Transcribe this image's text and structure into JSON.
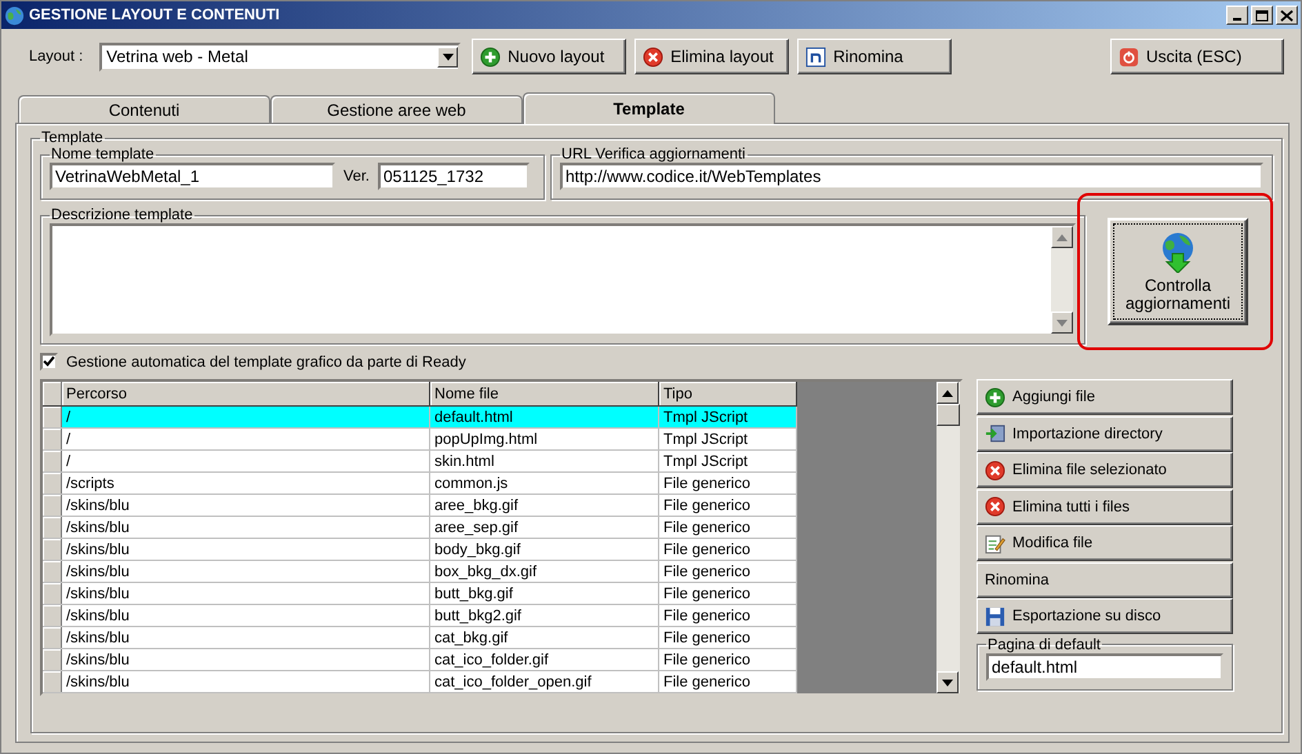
{
  "window": {
    "title": "GESTIONE LAYOUT E CONTENUTI"
  },
  "toolbar": {
    "layout_label": "Layout :",
    "layout_value": "Vetrina web - Metal",
    "buttons": [
      {
        "label": "Nuovo layout",
        "kind": "add"
      },
      {
        "label": "Elimina layout",
        "kind": "delete"
      },
      {
        "label": "Rinomina",
        "kind": "rename"
      }
    ],
    "exit_button": {
      "label": "Uscita (ESC)"
    }
  },
  "tabs": [
    {
      "label": "Contenuti",
      "selected": false
    },
    {
      "label": "Gestione aree web",
      "selected": false
    },
    {
      "label": "Template",
      "selected": true
    }
  ],
  "template": {
    "group_title": "Template",
    "name_group": "Nome template",
    "name_value": "VetrinaWebMetal_1",
    "ver_label": "Ver.",
    "ver_value": "051125_1732",
    "url_group": "URL Verifica aggiornamenti",
    "url_value": "http://www.codice.it/WebTemplates",
    "description_group": "Descrizione template",
    "check_button": "Controlla aggiornamenti",
    "auto_checkbox": {
      "label": "Gestione automatica del template grafico da parte di Ready",
      "checked": true
    }
  },
  "table": {
    "columns": [
      "Percorso",
      "Nome file",
      "Tipo"
    ],
    "rows": [
      {
        "cells": [
          "/",
          "default.html",
          "Tmpl JScript"
        ],
        "selected": true
      },
      {
        "cells": [
          "/",
          "popUpImg.html",
          "Tmpl JScript"
        ],
        "selected": false
      },
      {
        "cells": [
          "/",
          "skin.html",
          "Tmpl JScript"
        ],
        "selected": false
      },
      {
        "cells": [
          "/scripts",
          "common.js",
          "File generico"
        ],
        "selected": false
      },
      {
        "cells": [
          "/skins/blu",
          "aree_bkg.gif",
          "File generico"
        ],
        "selected": false
      },
      {
        "cells": [
          "/skins/blu",
          "aree_sep.gif",
          "File generico"
        ],
        "selected": false
      },
      {
        "cells": [
          "/skins/blu",
          "body_bkg.gif",
          "File generico"
        ],
        "selected": false
      },
      {
        "cells": [
          "/skins/blu",
          "box_bkg_dx.gif",
          "File generico"
        ],
        "selected": false
      },
      {
        "cells": [
          "/skins/blu",
          "butt_bkg.gif",
          "File generico"
        ],
        "selected": false
      },
      {
        "cells": [
          "/skins/blu",
          "butt_bkg2.gif",
          "File generico"
        ],
        "selected": false
      },
      {
        "cells": [
          "/skins/blu",
          "cat_bkg.gif",
          "File generico"
        ],
        "selected": false
      },
      {
        "cells": [
          "/skins/blu",
          "cat_ico_folder.gif",
          "File generico"
        ],
        "selected": false
      },
      {
        "cells": [
          "/skins/blu",
          "cat_ico_folder_open.gif",
          "File generico"
        ],
        "selected": false
      }
    ]
  },
  "file_buttons": [
    {
      "label": "Aggiungi file",
      "kind": "add"
    },
    {
      "label": "Importazione directory",
      "kind": "import"
    },
    {
      "label": "Elimina file selezionato",
      "kind": "delete"
    },
    {
      "label": "Elimina tutti i files",
      "kind": "delete"
    },
    {
      "label": "Modifica file",
      "kind": "edit"
    },
    {
      "label": "Rinomina",
      "kind": "text"
    },
    {
      "label": "Esportazione su disco",
      "kind": "save"
    }
  ],
  "default_page": {
    "group_title": "Pagina di default",
    "value": "default.html"
  }
}
